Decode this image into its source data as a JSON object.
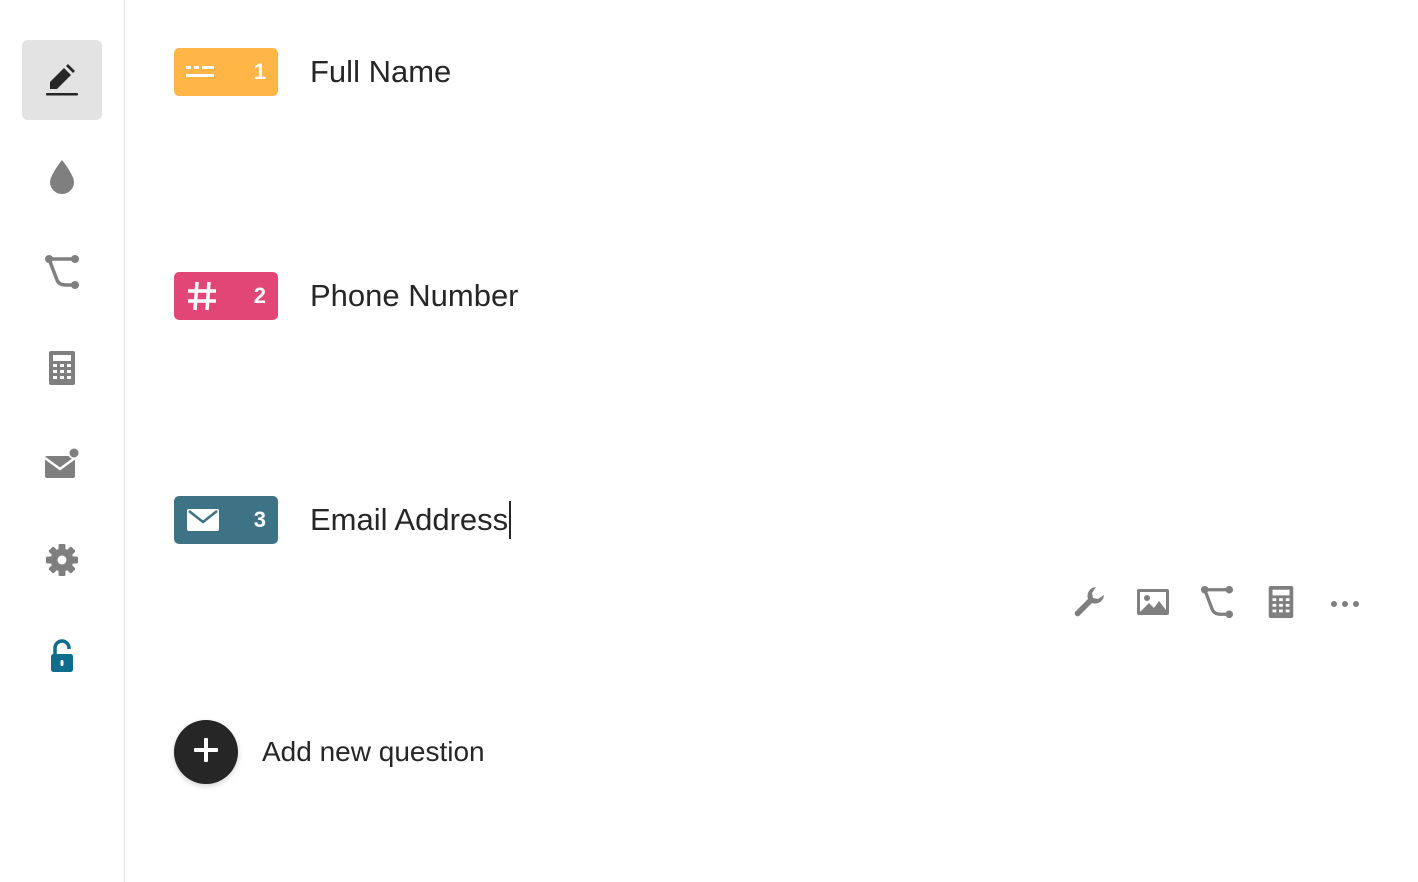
{
  "sidebar": {
    "items": [
      {
        "name": "build",
        "icon": "pen-icon",
        "active": true
      },
      {
        "name": "design",
        "icon": "drop-icon",
        "active": false
      },
      {
        "name": "logic",
        "icon": "logic-jump-icon",
        "active": false
      },
      {
        "name": "calculator",
        "icon": "calculator-icon",
        "active": false
      },
      {
        "name": "notifications",
        "icon": "mail-notification-icon",
        "active": false
      },
      {
        "name": "settings",
        "icon": "gear-icon",
        "active": false
      },
      {
        "name": "access",
        "icon": "unlocked-lock-icon",
        "active": false
      }
    ]
  },
  "questions": [
    {
      "number": "1",
      "title": "Full Name",
      "type_icon": "short-text-icon",
      "color": "#FFB646"
    },
    {
      "number": "2",
      "title": "Phone Number",
      "type_icon": "hash-icon",
      "color": "#E24676"
    },
    {
      "number": "3",
      "title": "Email Address",
      "type_icon": "envelope-icon",
      "color": "#3D7384"
    }
  ],
  "toolbar": {
    "items": [
      "wrench-icon",
      "image-icon",
      "logic-jump-icon",
      "calculator-icon",
      "more-icon"
    ]
  },
  "add_question": {
    "label": "Add new question",
    "icon": "plus-icon"
  },
  "colors": {
    "sidebar_active_bg": "#E3E3E3",
    "icon_gray": "#7F7F7F",
    "lock_blue": "#0E6C8C",
    "text": "#262627"
  }
}
